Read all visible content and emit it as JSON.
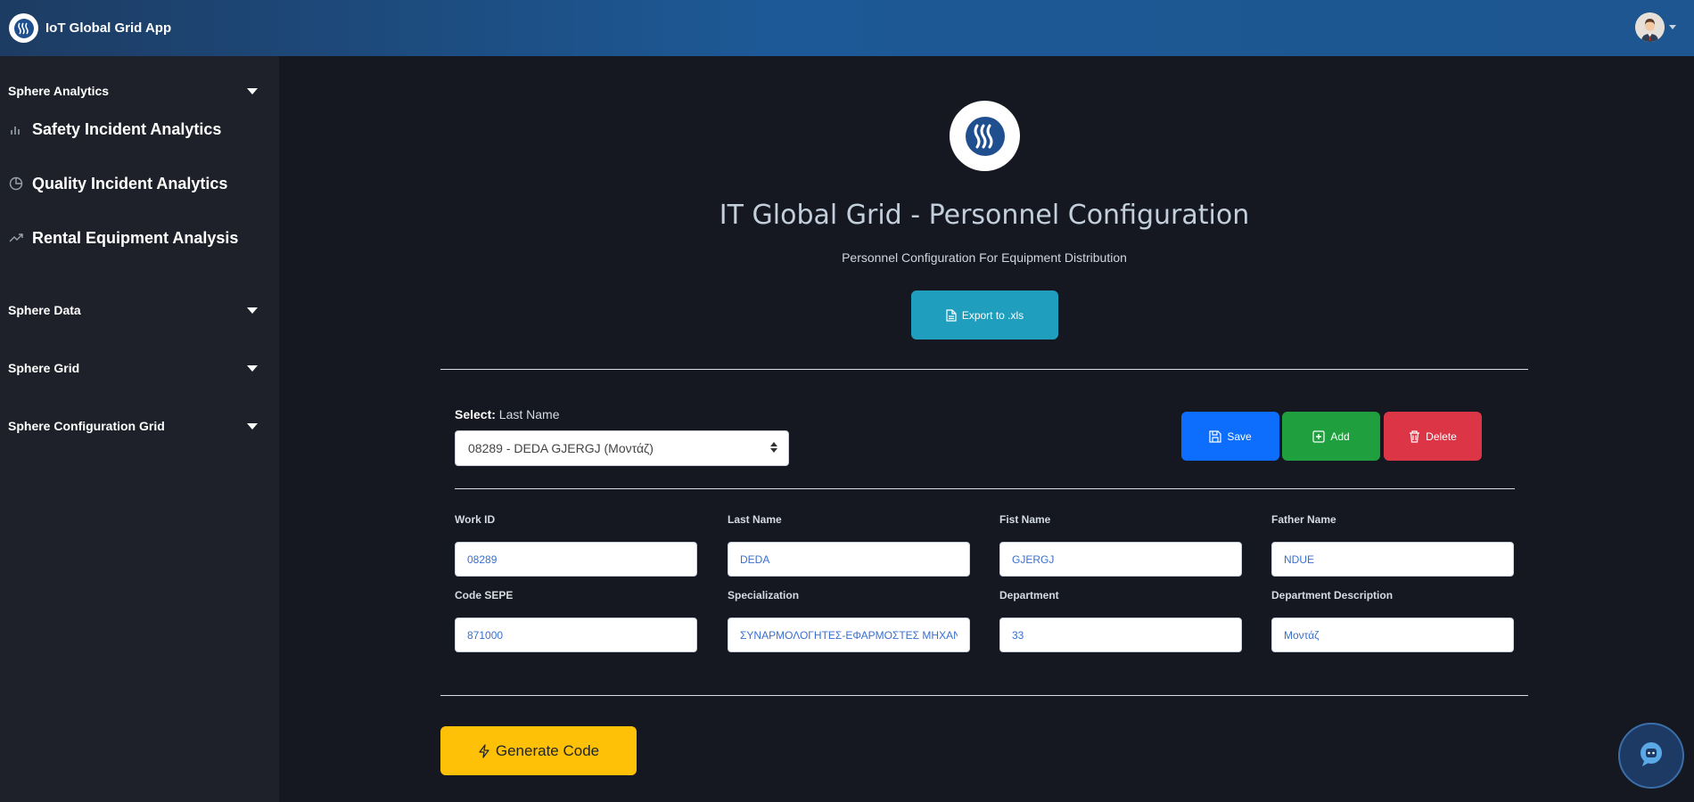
{
  "app": {
    "title": "IoT Global Grid App"
  },
  "header": {
    "avatar_icon": "user-avatar-icon"
  },
  "sidebar": {
    "sections": [
      {
        "label": "Sphere Analytics"
      },
      {
        "label": "Sphere Data"
      },
      {
        "label": "Sphere Grid"
      },
      {
        "label": "Sphere Configuration Grid"
      }
    ],
    "items": [
      {
        "label": "Safety Incident Analytics",
        "icon": "bar-chart-icon"
      },
      {
        "label": "Quality Incident Analytics",
        "icon": "pie-chart-icon"
      },
      {
        "label": "Rental Equipment Analysis",
        "icon": "trend-up-icon"
      }
    ]
  },
  "main": {
    "title": "IT Global Grid - Personnel Configuration",
    "subtitle": "Personnel Configuration For Equipment Distribution",
    "export_label": "Export to .xls",
    "select": {
      "label_bold": "Select:",
      "label_rest": " Last Name",
      "value": "08289 - DEDA GJERGJ (Μοντάζ)"
    },
    "actions": {
      "save": "Save",
      "add": "Add",
      "delete": "Delete"
    },
    "fields": [
      {
        "label": "Work ID",
        "value": "08289"
      },
      {
        "label": "Last Name",
        "value": "DEDA"
      },
      {
        "label": "Fist Name",
        "value": "GJERGJ"
      },
      {
        "label": "Father Name",
        "value": "NDUE"
      },
      {
        "label": "Code SEPE",
        "value": "871000"
      },
      {
        "label": "Specialization",
        "value": "ΣΥΝΑΡΜΟΛΟΓΗΤΕΣ-ΕΦΑΡΜΟΣΤΕΣ ΜΗΧΑΝΗΜΑΤΩΝ"
      },
      {
        "label": "Department",
        "value": "33"
      },
      {
        "label": "Department Description",
        "value": "Μοντάζ"
      }
    ],
    "generate_label": "Generate Code"
  },
  "colors": {
    "accent_primary": "#0d6efd",
    "accent_success": "#1f9f3e",
    "accent_danger": "#dc3545",
    "accent_info": "#1f9fbd",
    "accent_warning": "#ffc107"
  }
}
